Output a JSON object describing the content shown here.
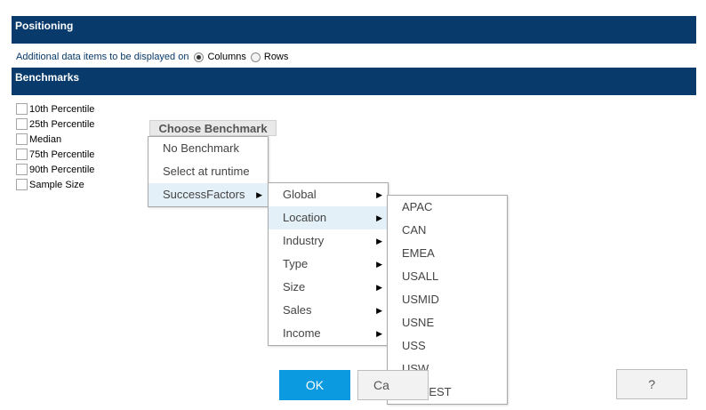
{
  "positioning": {
    "title": "Positioning",
    "label": "Additional data items to be displayed on",
    "options": [
      {
        "label": "Columns",
        "checked": true
      },
      {
        "label": "Rows",
        "checked": false
      }
    ]
  },
  "benchmarks": {
    "title": "Benchmarks",
    "items": [
      {
        "label": "10th Percentile",
        "checked": false
      },
      {
        "label": "25th Percentile",
        "checked": false
      },
      {
        "label": "Median",
        "checked": false
      },
      {
        "label": "75th Percentile",
        "checked": false
      },
      {
        "label": "90th Percentile",
        "checked": false
      },
      {
        "label": "Sample Size",
        "checked": false
      }
    ],
    "choose_button": "Choose Benchmark"
  },
  "menu_level1": {
    "items": [
      {
        "label": "No Benchmark",
        "submenu": false,
        "active": false
      },
      {
        "label": "Select at runtime",
        "submenu": false,
        "active": false
      },
      {
        "label": "SuccessFactors",
        "submenu": true,
        "active": true
      }
    ]
  },
  "menu_level2": {
    "items": [
      {
        "label": "Global",
        "submenu": true,
        "active": false
      },
      {
        "label": "Location",
        "submenu": true,
        "active": true
      },
      {
        "label": "Industry",
        "submenu": true,
        "active": false
      },
      {
        "label": "Type",
        "submenu": true,
        "active": false
      },
      {
        "label": "Size",
        "submenu": true,
        "active": false
      },
      {
        "label": "Sales",
        "submenu": true,
        "active": false
      },
      {
        "label": "Income",
        "submenu": true,
        "active": false
      }
    ]
  },
  "menu_level3": {
    "items": [
      "APAC",
      "CAN",
      "EMEA",
      "USALL",
      "USMID",
      "USNE",
      "USS",
      "USW",
      "USWEST"
    ]
  },
  "footer": {
    "ok_label": "OK",
    "cancel_label": "Ca",
    "help_label": "?"
  },
  "colors": {
    "header_band": "#083a6b",
    "ok_button": "#0b9ae0",
    "menu_highlight": "#e3f0f8"
  },
  "icons": {
    "submenu_arrow": "caret-right-icon"
  }
}
